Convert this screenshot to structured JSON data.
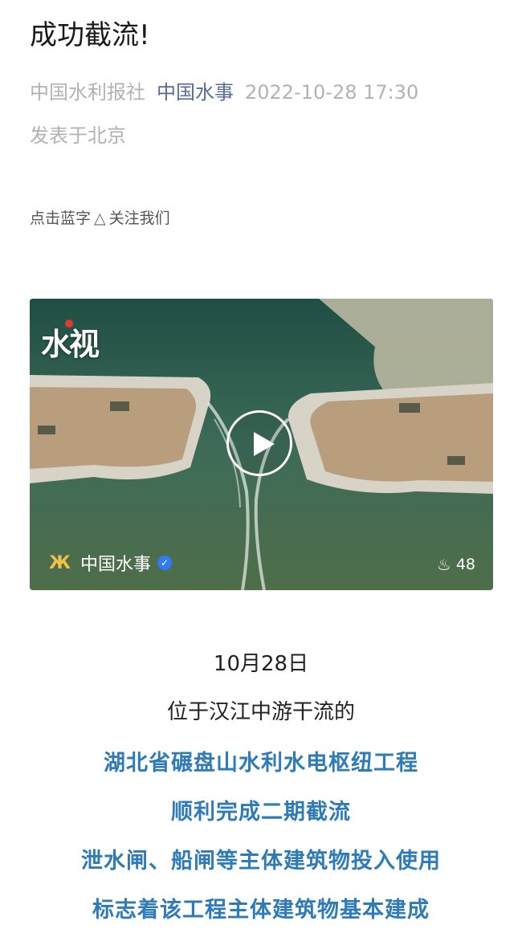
{
  "article": {
    "title": "成功截流!",
    "publisher": "中国水利报社",
    "account": "中国水事",
    "datetime": "2022-10-28 17:30",
    "location": "发表于北京",
    "follow_prompt_left": "点击蓝字",
    "follow_prompt_icon": "triangle-up-icon",
    "follow_prompt_right": "关注我们"
  },
  "video": {
    "watermark": "水视",
    "channel_name": "中国水事",
    "likes": "48",
    "icons": [
      "play-icon",
      "butterfly-icon",
      "verified-icon",
      "flame-icon"
    ]
  },
  "content": {
    "date_line": "10月28日",
    "line1": "位于汉江中游干流的",
    "highlight1": "湖北省碾盘山水利水电枢纽工程",
    "highlight2": "顺利完成二期截流",
    "highlight3": "泄水闸、船闸等主体建筑物投入使用",
    "highlight4": "标志着该工程主体建筑物基本建成"
  },
  "colors": {
    "accent_blue": "#2e7bb8",
    "link_blue": "#576b95",
    "muted": "#b2b2b2"
  }
}
